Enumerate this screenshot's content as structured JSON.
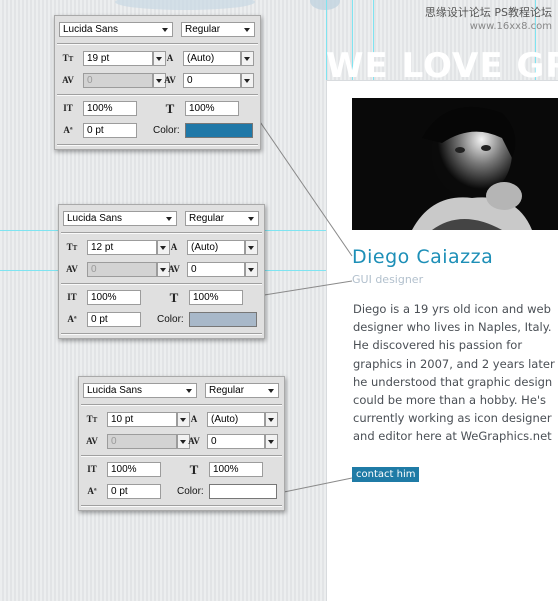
{
  "watermark": {
    "text": "思缘设计论坛",
    "url": "www.16xx8.com",
    "url_alt": "PS教程论坛"
  },
  "hero": {
    "text": "WE LOVE GR"
  },
  "profile": {
    "name": "Diego Caiazza",
    "role": "GUI designer",
    "bio": "Diego is a 19 yrs old icon and web designer who lives in Naples, Italy. He discovered his passion for graphics in 2007, and 2 years later he understood that graphic design could be more than a hobby. He's currently working as icon designer and editor here at WeGraphics.net",
    "button": "contact him"
  },
  "panels": [
    {
      "font": "Lucida Sans",
      "style": "Regular",
      "size": "19 pt",
      "leading": "(Auto)",
      "kerning": "0",
      "tracking": "0",
      "vscale": "100%",
      "hscale": "100%",
      "baseline": "0 pt",
      "color_label": "Color:",
      "color": "#1f78a8"
    },
    {
      "font": "Lucida Sans",
      "style": "Regular",
      "size": "12 pt",
      "leading": "(Auto)",
      "kerning": "0",
      "tracking": "0",
      "vscale": "100%",
      "hscale": "100%",
      "baseline": "0 pt",
      "color_label": "Color:",
      "color": "#a8b8c9"
    },
    {
      "font": "Lucida Sans",
      "style": "Regular",
      "size": "10 pt",
      "leading": "(Auto)",
      "kerning": "0",
      "tracking": "0",
      "vscale": "100%",
      "hscale": "100%",
      "baseline": "0 pt",
      "color_label": "Color:",
      "color": "#ffffff"
    }
  ],
  "icons": {
    "size": "font-size-icon",
    "leading": "leading-icon",
    "kerning": "kerning-icon",
    "tracking": "tracking-icon",
    "vscale": "vertical-scale-icon",
    "hscale": "horizontal-scale-icon",
    "baseline": "baseline-shift-icon"
  }
}
